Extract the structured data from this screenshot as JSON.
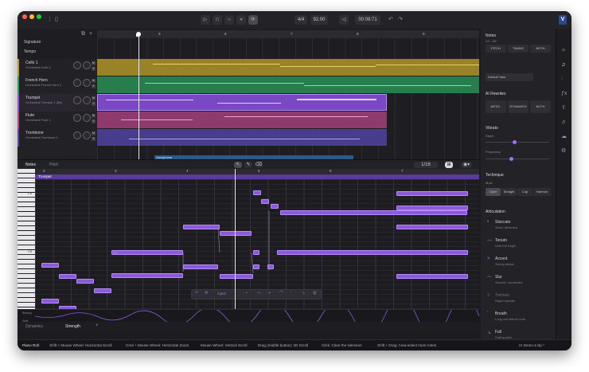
{
  "transport": {
    "time_signature": "4/4",
    "tempo": "92.00",
    "time": "00:09:71"
  },
  "arrangement": {
    "bar_numbers": [
      "5",
      "6",
      "7",
      "8",
      "9"
    ],
    "lane_labels": {
      "signature": "Signature",
      "tempo": "Tempo"
    },
    "tracks": [
      {
        "name": "Cello 1",
        "instrument": "Orchestral Cello 1",
        "color": "#b89a2c"
      },
      {
        "name": "French Horn",
        "instrument": "Orchestral French Horn 1",
        "color": "#2e9c5e"
      },
      {
        "name": "Trumpet",
        "instrument": "Orchestral Trumpet 1 (Bb)",
        "color": "#8a54d6"
      },
      {
        "name": "Flute",
        "instrument": "Orchestral Flute 1",
        "color": "#b04a86"
      },
      {
        "name": "Trombone",
        "instrument": "Orchestral Trombone 1",
        "color": "#5a4aa8"
      }
    ],
    "extra_region_label": "Saxophone"
  },
  "pianoroll": {
    "tabs": [
      "Notes",
      "Pitch"
    ],
    "quantize": "1/16",
    "bar_numbers": [
      "2",
      "3",
      "4",
      "5",
      "6",
      "7"
    ],
    "region_label": "Trumpet",
    "key_labels": [
      "C6",
      "C5"
    ],
    "floating_toolbar": {
      "mode": "Open"
    },
    "lane_labels": [
      "Brning",
      "Soft"
    ],
    "bottom_tabs": [
      "Dynamics",
      "Strength"
    ]
  },
  "inspector": {
    "notes_title": "Notes",
    "notes_range": "A3 - D6",
    "notes_buttons": [
      "PITCH",
      "TIMING",
      "BOTH"
    ],
    "take": "Default Take",
    "ai_rewrites_title": "AI Rewrites",
    "ai_buttons": [
      "ARTIC.",
      "DYNAMICS",
      "BOTH"
    ],
    "vibrato_title": "Vibrato",
    "vibrato_params": [
      {
        "name": "Depth",
        "value": 0.45
      },
      {
        "name": "Frequency",
        "value": 0.4
      }
    ],
    "technique_title": "Technique",
    "mute_label": "Mute",
    "mute_options": [
      "Open",
      "Straight",
      "Cup",
      "Harmon"
    ],
    "articulation_title": "Articulation",
    "articulations": [
      {
        "name": "Staccato",
        "desc": "Short, detached",
        "icon": "•"
      },
      {
        "name": "Tenuto",
        "desc": "Held full length",
        "icon": "—"
      },
      {
        "name": "Accent",
        "desc": "Strong attack",
        "icon": ">"
      },
      {
        "name": "Slur",
        "desc": "Smooth, connected",
        "icon": "⌒"
      },
      {
        "name": "Tremolo",
        "desc": "Rapid repeats",
        "icon": "≡"
      },
      {
        "name": "Breath",
        "desc": "Long rest before note",
        "icon": "’"
      },
      {
        "name": "Fall",
        "desc": "Falling pitch",
        "icon": "↘"
      }
    ]
  },
  "statusbar": {
    "mode": "Piano Roll",
    "hints": [
      "Shift + Mouse Wheel: Horizontal Scroll",
      "Cmd + Mouse Wheel: Horizontal Zoom",
      "Mouse Wheel: Vertical Scroll",
      "Drag (middle button): 2D Scroll",
      "Click: Clear the selection",
      "Shift + Drag: Area-select more notes"
    ],
    "project": "IX Demo 2.isp *"
  }
}
